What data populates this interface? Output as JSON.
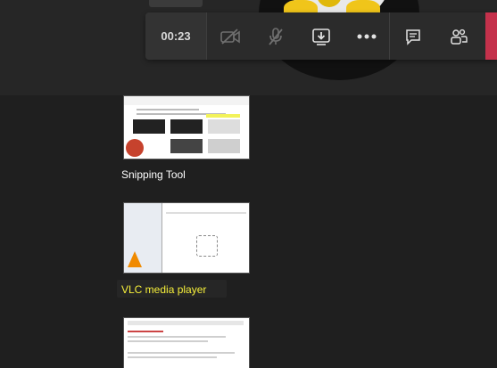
{
  "meeting": {
    "timer": "00:23"
  },
  "controls": [
    {
      "name": "camera-off",
      "label": "Turn camera on"
    },
    {
      "name": "mic-off",
      "label": "Unmute"
    },
    {
      "name": "share",
      "label": "Share"
    },
    {
      "name": "more",
      "label": "More actions"
    },
    {
      "name": "chat",
      "label": "Show conversation"
    },
    {
      "name": "participants",
      "label": "Show participants"
    }
  ],
  "share_tray": {
    "windows": [
      {
        "label": "Snipping Tool",
        "highlighted": false
      },
      {
        "label": "VLC media player",
        "highlighted": true
      },
      {
        "label": "",
        "highlighted": false
      }
    ]
  },
  "colors": {
    "background": "#1f1f1f",
    "control_bar": "#2b2b2b",
    "leave_button": "#c4314b",
    "highlight_text": "#f6ef3a"
  }
}
